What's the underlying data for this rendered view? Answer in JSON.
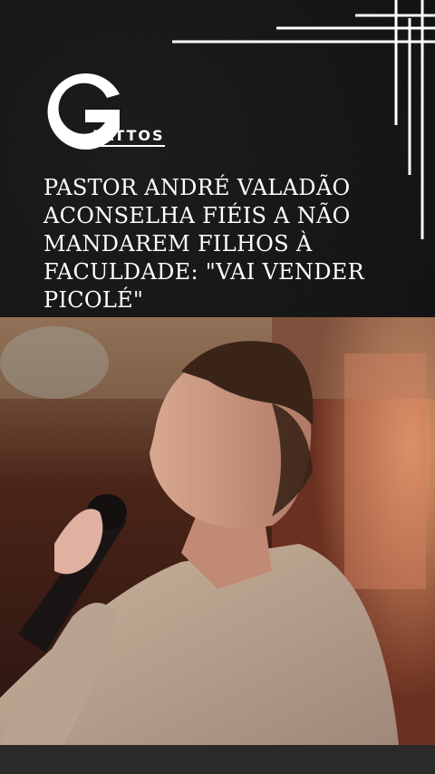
{
  "brand": {
    "logo_letter": "G",
    "logo_word": "FATTOS"
  },
  "headline": "PASTOR ANDRÉ VALADÃO ACONSELHA FIÉIS A NÃO MANDAREM FILHOS À FACULDADE: \"VAI VENDER PICOLÉ\"",
  "colors": {
    "background": "#141414",
    "text": "#ffffff",
    "accent_lines": "#ffffff"
  },
  "photo": {
    "subject": "man holding microphone"
  }
}
